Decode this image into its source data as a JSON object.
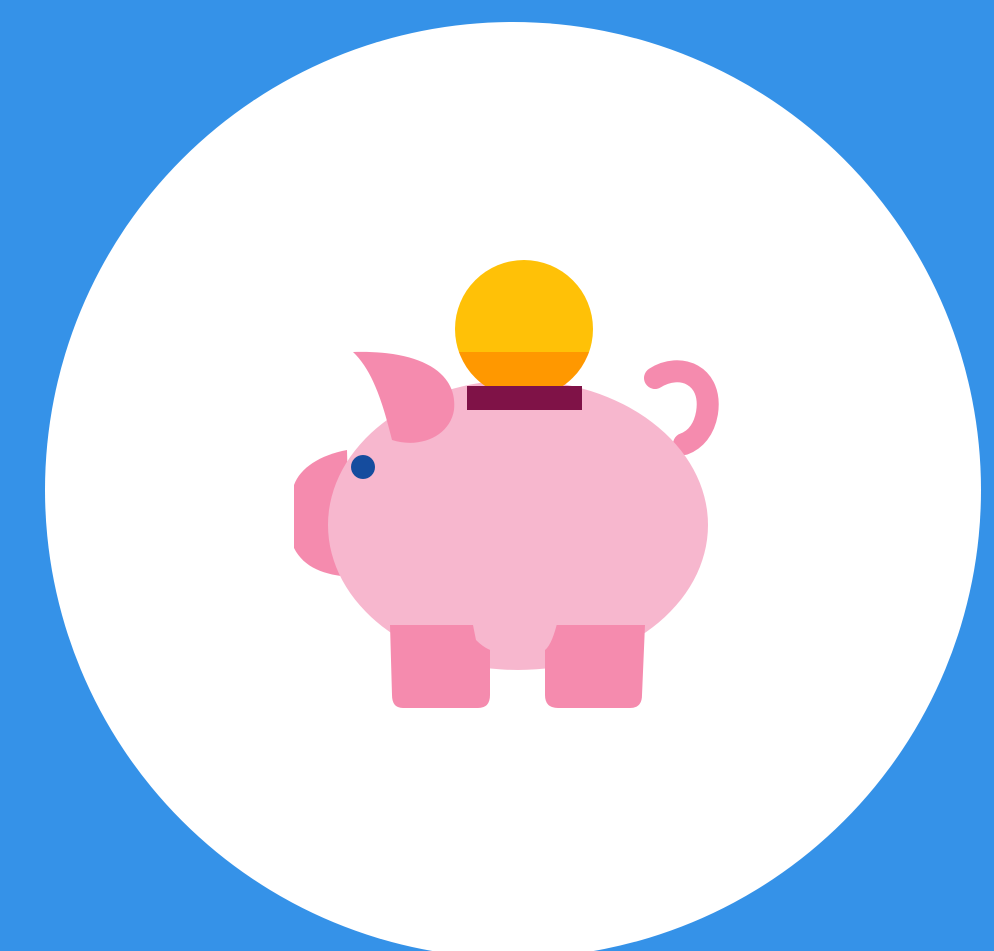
{
  "colors": {
    "background": "#3592E8",
    "circle": "#FFFFFF",
    "pig_body": "#F7B7CE",
    "pig_accent": "#F58BAE",
    "eye": "#154C9E",
    "slot": "#7F1247",
    "coin_top": "#FFC107",
    "coin_bottom": "#FF9800"
  },
  "icons": {
    "main": "piggy-bank-icon",
    "coin": "coin-icon"
  }
}
